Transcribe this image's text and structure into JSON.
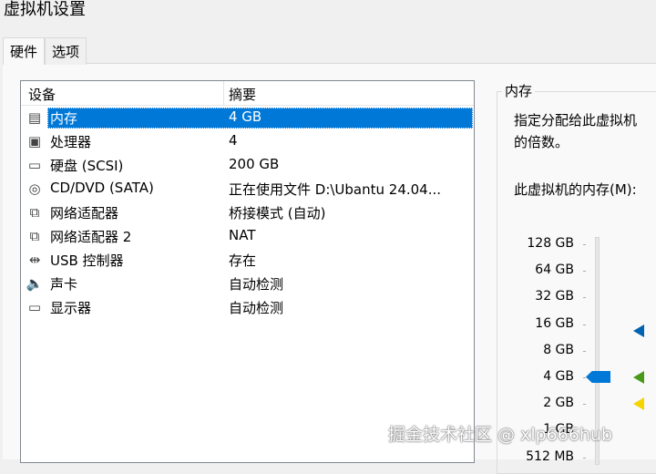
{
  "window": {
    "title": "虚拟机设置"
  },
  "tabs": [
    {
      "label": "硬件"
    },
    {
      "label": "选项"
    }
  ],
  "device_list": {
    "headers": {
      "device": "设备",
      "summary": "摘要"
    },
    "rows": [
      {
        "icon": "memory-icon",
        "name": "内存",
        "summary": "4 GB",
        "selected": true
      },
      {
        "icon": "cpu-icon",
        "name": "处理器",
        "summary": "4"
      },
      {
        "icon": "hard-disk-icon",
        "name": "硬盘 (SCSI)",
        "summary": "200 GB"
      },
      {
        "icon": "cd-dvd-icon",
        "name": "CD/DVD (SATA)",
        "summary": "正在使用文件 D:\\Ubantu 24.04..."
      },
      {
        "icon": "network-adapter-icon",
        "name": "网络适配器",
        "summary": "桥接模式 (自动)"
      },
      {
        "icon": "network-adapter-icon",
        "name": "网络适配器 2",
        "summary": "NAT"
      },
      {
        "icon": "usb-icon",
        "name": "USB 控制器",
        "summary": "存在"
      },
      {
        "icon": "sound-icon",
        "name": "声卡",
        "summary": "自动检测"
      },
      {
        "icon": "display-icon",
        "name": "显示器",
        "summary": "自动检测"
      }
    ]
  },
  "memory_panel": {
    "group_label": "内存",
    "description_line1": "指定分配给此虚拟机",
    "description_line2": "的倍数。",
    "memory_label": "此虚拟机的内存(M):",
    "scale_labels": [
      "128 GB",
      "64 GB",
      "32 GB",
      "16 GB",
      "8 GB",
      "4 GB",
      "2 GB",
      "1 GB",
      "512 MB"
    ],
    "current_value": "4 GB",
    "markers": {
      "blue": "#0063b1",
      "green": "#4a9a1a",
      "yellow": "#f5d400"
    }
  },
  "watermark": "掘金技术社区 @ xlp666hub"
}
